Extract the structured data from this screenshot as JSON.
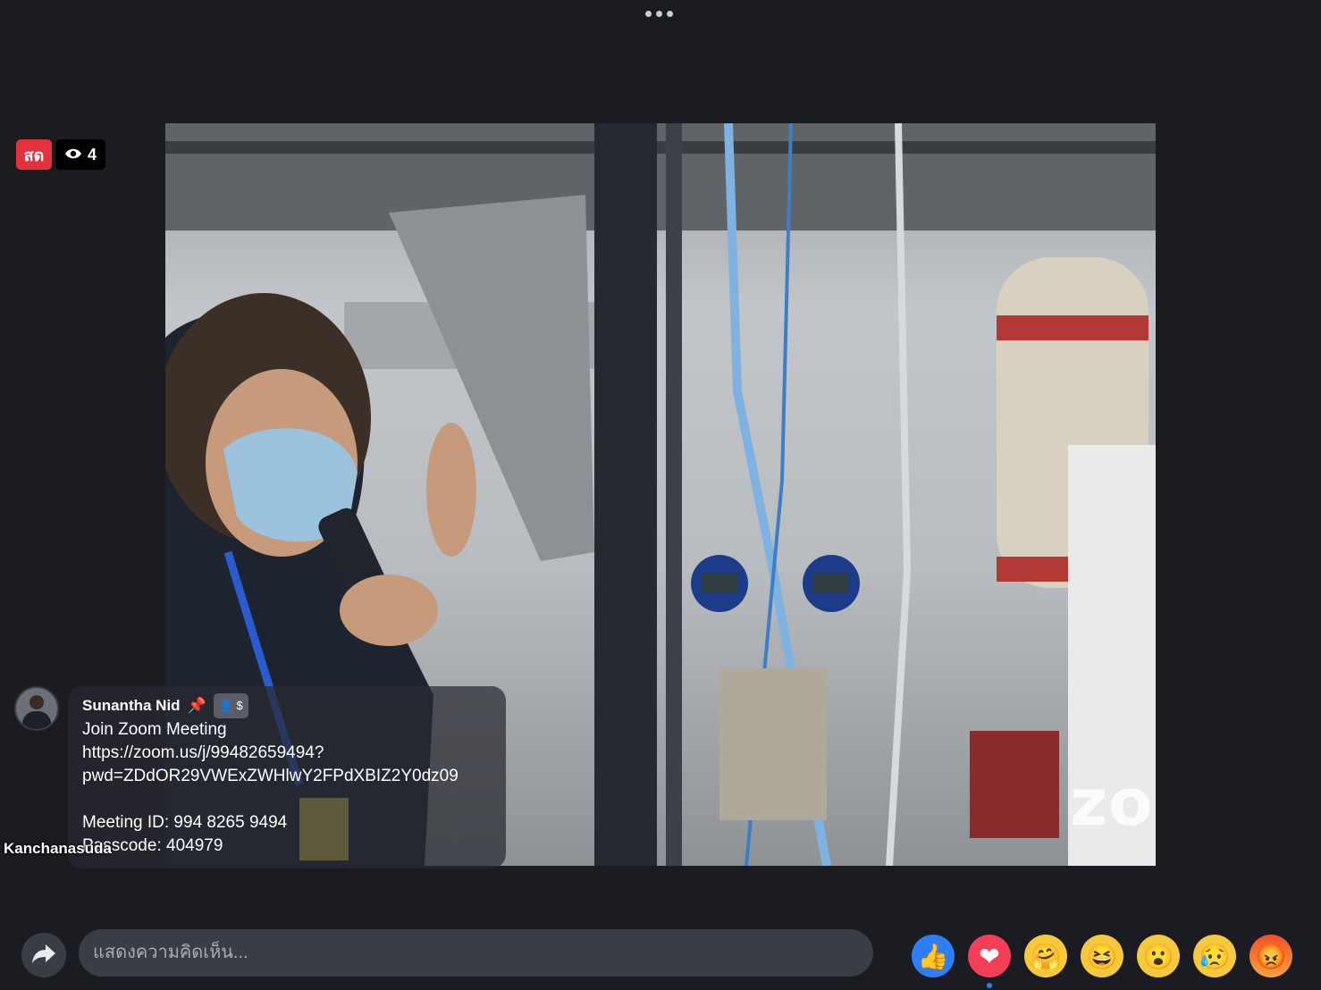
{
  "live_badge": "สด",
  "viewer_count": "4",
  "speaker_name": "Kanchanasuda",
  "watermark": "zoom",
  "comment": {
    "author": "Sunantha Nid",
    "lines": [
      "Join Zoom Meeting",
      "https://zoom.us/j/99482659494?",
      "pwd=ZDdOR29VWExZWHlwY2FPdXBIZ2Y0dz09",
      "",
      "Meeting ID: 994 8265 9494",
      "Passcode: 404979"
    ]
  },
  "input": {
    "placeholder": "แสดงความคิดเห็น..."
  },
  "icons": {
    "share": "share-arrow-icon",
    "pin": "pin-icon",
    "moderator": "moderator-icon",
    "view": "eye-icon"
  },
  "reactions": [
    {
      "name": "like",
      "glyph": "👍"
    },
    {
      "name": "love",
      "glyph": "❤"
    },
    {
      "name": "care",
      "glyph": "🤗"
    },
    {
      "name": "haha",
      "glyph": "😆"
    },
    {
      "name": "wow",
      "glyph": "😮"
    },
    {
      "name": "sad",
      "glyph": "😥"
    },
    {
      "name": "angry",
      "glyph": "😡"
    }
  ],
  "colors": {
    "live": "#e4313e",
    "like": "#2d7ff9",
    "love": "#f33e58",
    "background": "#1a1c22"
  }
}
